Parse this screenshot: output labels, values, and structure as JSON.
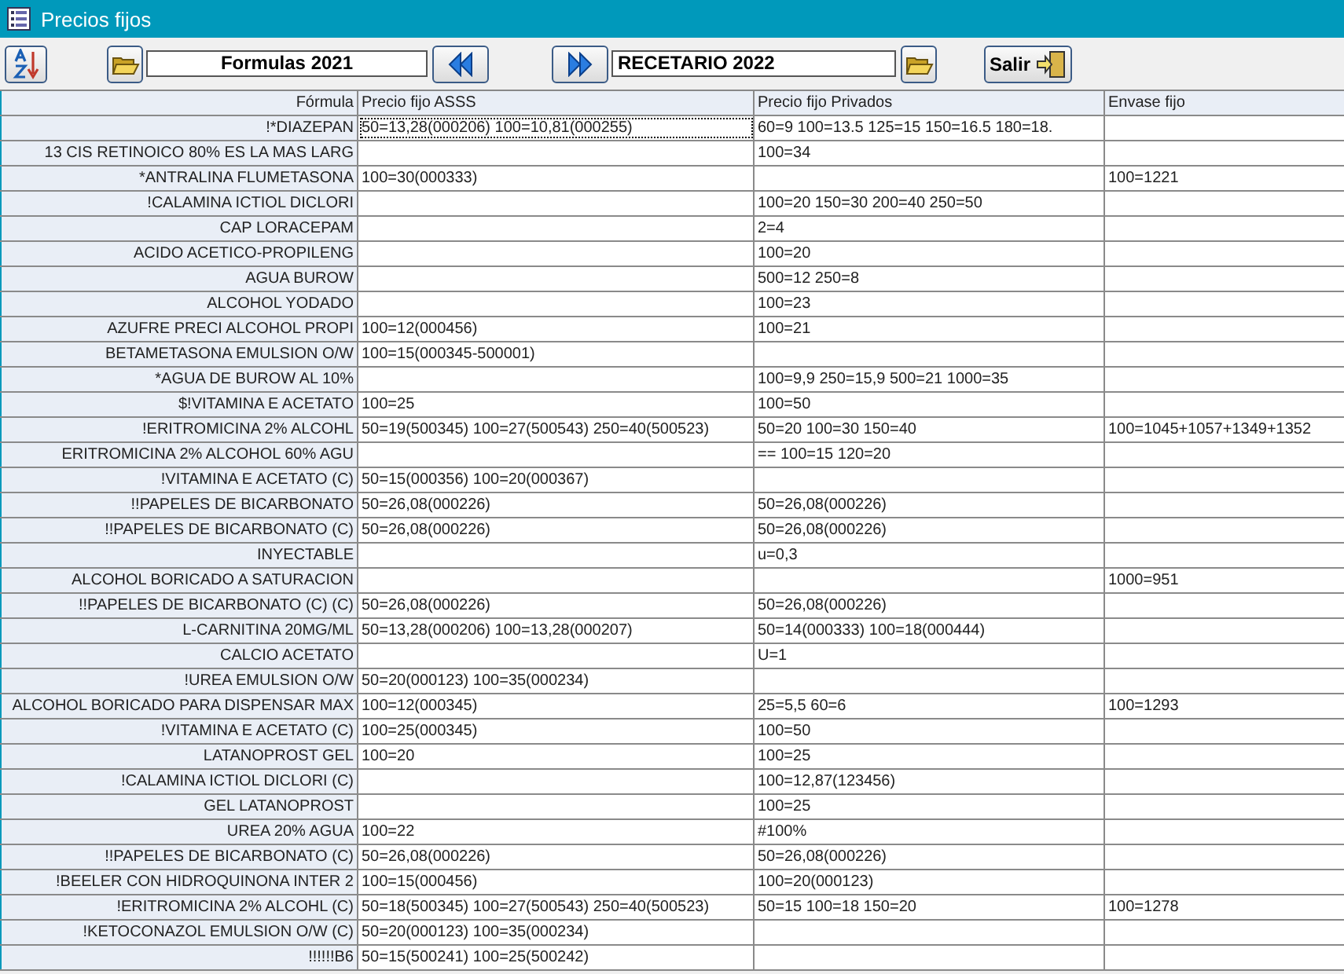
{
  "window": {
    "title": "Precios fijos"
  },
  "toolbar": {
    "source_field": "Formulas 2021",
    "target_field": "RECETARIO 2022",
    "exit_button": "Salir"
  },
  "table": {
    "columns": [
      "Fórmula",
      "Precio fijo ASSS",
      "Precio fijo Privados",
      "Envase fijo"
    ],
    "rows": [
      {
        "cells": [
          "!*DIAZEPAN",
          "50=13,28(000206) 100=10,81(000255)",
          "60=9 100=13.5 125=15 150=16.5 180=18.",
          ""
        ],
        "focused": true
      },
      {
        "cells": [
          "13 CIS RETINOICO 80% ES LA MAS LARG",
          "",
          "100=34",
          ""
        ],
        "focused": false
      },
      {
        "cells": [
          "*ANTRALINA FLUMETASONA",
          "100=30(000333)",
          "",
          "100=1221"
        ],
        "focused": false
      },
      {
        "cells": [
          "!CALAMINA ICTIOL DICLORI",
          "",
          "100=20 150=30 200=40 250=50",
          ""
        ],
        "focused": false
      },
      {
        "cells": [
          "CAP LORACEPAM",
          "",
          "2=4",
          ""
        ],
        "focused": false
      },
      {
        "cells": [
          "ACIDO ACETICO-PROPILENG",
          "",
          "100=20",
          ""
        ],
        "focused": false
      },
      {
        "cells": [
          "AGUA BUROW",
          "",
          "500=12 250=8",
          ""
        ],
        "focused": false
      },
      {
        "cells": [
          "ALCOHOL YODADO",
          "",
          "100=23",
          ""
        ],
        "focused": false
      },
      {
        "cells": [
          "AZUFRE PRECI ALCOHOL PROPI",
          "100=12(000456)",
          "100=21",
          ""
        ],
        "focused": false
      },
      {
        "cells": [
          "BETAMETASONA EMULSION O/W",
          "100=15(000345-500001)",
          "",
          ""
        ],
        "focused": false
      },
      {
        "cells": [
          "*AGUA DE BUROW AL 10%",
          "",
          "100=9,9 250=15,9 500=21 1000=35",
          ""
        ],
        "focused": false
      },
      {
        "cells": [
          "$!VITAMINA E ACETATO",
          "100=25",
          "100=50",
          ""
        ],
        "focused": false
      },
      {
        "cells": [
          "!ERITROMICINA 2% ALCOHL",
          "50=19(500345) 100=27(500543) 250=40(500523)",
          "50=20 100=30 150=40",
          "100=1045+1057+1349+1352"
        ],
        "focused": false
      },
      {
        "cells": [
          "ERITROMICINA 2% ALCOHOL 60% AGU",
          "",
          "== 100=15 120=20",
          ""
        ],
        "focused": false
      },
      {
        "cells": [
          "!VITAMINA E ACETATO (C)",
          "50=15(000356) 100=20(000367)",
          "",
          ""
        ],
        "focused": false
      },
      {
        "cells": [
          "!!PAPELES DE BICARBONATO",
          "50=26,08(000226)",
          "50=26,08(000226)",
          ""
        ],
        "focused": false
      },
      {
        "cells": [
          "!!PAPELES DE BICARBONATO (C)",
          "50=26,08(000226)",
          "50=26,08(000226)",
          ""
        ],
        "focused": false
      },
      {
        "cells": [
          "INYECTABLE",
          "",
          "u=0,3",
          ""
        ],
        "focused": false
      },
      {
        "cells": [
          "ALCOHOL BORICADO A SATURACION",
          "",
          "",
          "1000=951"
        ],
        "focused": false
      },
      {
        "cells": [
          "!!PAPELES DE BICARBONATO (C) (C)",
          "50=26,08(000226)",
          "50=26,08(000226)",
          ""
        ],
        "focused": false
      },
      {
        "cells": [
          "L-CARNITINA 20MG/ML",
          "50=13,28(000206) 100=13,28(000207)",
          "50=14(000333) 100=18(000444)",
          ""
        ],
        "focused": false
      },
      {
        "cells": [
          "CALCIO ACETATO",
          "",
          "U=1",
          ""
        ],
        "focused": false
      },
      {
        "cells": [
          "!UREA EMULSION O/W",
          "50=20(000123) 100=35(000234)",
          "",
          ""
        ],
        "focused": false
      },
      {
        "cells": [
          "ALCOHOL BORICADO PARA DISPENSAR MAX",
          "100=12(000345)",
          "25=5,5 60=6",
          "100=1293"
        ],
        "focused": false
      },
      {
        "cells": [
          "!VITAMINA E ACETATO (C)",
          "100=25(000345)",
          "100=50",
          ""
        ],
        "focused": false
      },
      {
        "cells": [
          "LATANOPROST GEL",
          "100=20",
          "100=25",
          ""
        ],
        "focused": false
      },
      {
        "cells": [
          "!CALAMINA ICTIOL DICLORI (C)",
          "",
          "100=12,87(123456)",
          ""
        ],
        "focused": false
      },
      {
        "cells": [
          "GEL LATANOPROST",
          "",
          "100=25",
          ""
        ],
        "focused": false
      },
      {
        "cells": [
          "UREA 20% AGUA",
          "100=22",
          "#100%",
          ""
        ],
        "focused": false
      },
      {
        "cells": [
          "!!PAPELES DE BICARBONATO (C)",
          "50=26,08(000226)",
          "50=26,08(000226)",
          ""
        ],
        "focused": false
      },
      {
        "cells": [
          "!BEELER CON HIDROQUINONA INTER 2",
          "100=15(000456)",
          "100=20(000123)",
          ""
        ],
        "focused": false
      },
      {
        "cells": [
          "!ERITROMICINA 2% ALCOHL (C)",
          "50=18(500345) 100=27(500543) 250=40(500523)",
          "50=15 100=18 150=20",
          "100=1278"
        ],
        "focused": false
      },
      {
        "cells": [
          "!KETOCONAZOL EMULSION O/W (C)",
          "50=20(000123) 100=35(000234)",
          "",
          ""
        ],
        "focused": false
      },
      {
        "cells": [
          "!!!!!!B6",
          "50=15(500241) 100=25(500242)",
          "",
          ""
        ],
        "focused": false
      }
    ]
  }
}
